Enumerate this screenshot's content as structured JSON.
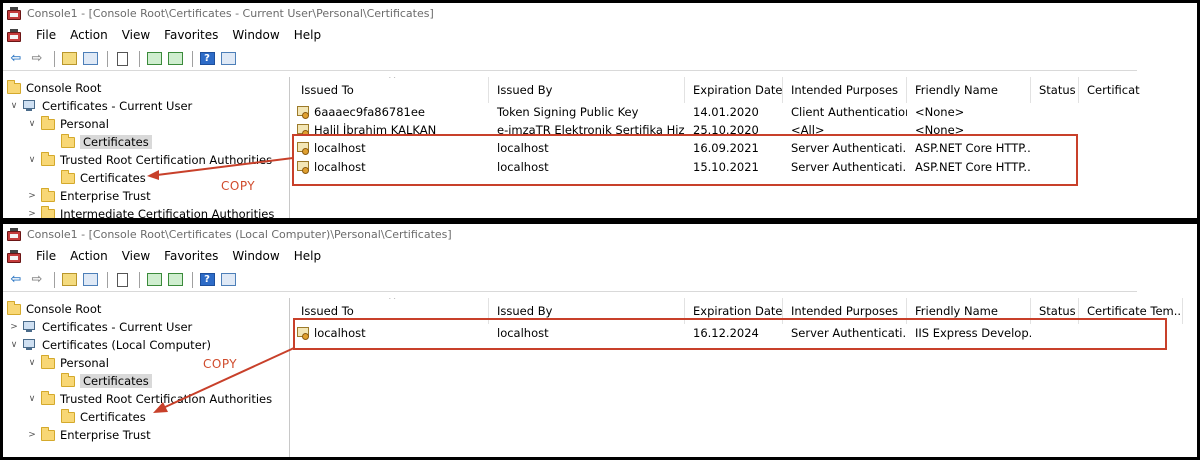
{
  "colors": {
    "annotation": "#c8402a",
    "selection": "#d9d9d9"
  },
  "annotation": {
    "copy_label": "COPY"
  },
  "toolbar_icons": [
    "back-arrow-icon",
    "forward-arrow-icon",
    "up-folder-icon",
    "show-hide-tree-icon",
    "properties-icon",
    "refresh-icon",
    "export-list-icon",
    "help-icon",
    "action-pane-icon"
  ],
  "menu": [
    "File",
    "Action",
    "View",
    "Favorites",
    "Window",
    "Help"
  ],
  "window1": {
    "title": "Console1 - [Console Root\\Certificates - Current User\\Personal\\Certificates]",
    "tree": [
      {
        "label": "Console Root",
        "chev": "",
        "icon": "folder"
      },
      {
        "label": "Certificates - Current User",
        "chev": "∨",
        "icon": "cert-store"
      },
      {
        "label": "Personal",
        "chev": "∨",
        "icon": "folder"
      },
      {
        "label": "Certificates",
        "chev": "",
        "icon": "folder",
        "selected": true
      },
      {
        "label": "Trusted Root Certification Authorities",
        "chev": "∨",
        "icon": "folder"
      },
      {
        "label": "Certificates",
        "chev": "",
        "icon": "folder"
      },
      {
        "label": "Enterprise Trust",
        "chev": ">",
        "icon": "folder"
      },
      {
        "label": "Intermediate Certification Authorities",
        "chev": ">",
        "icon": "folder"
      }
    ],
    "columns": [
      "Issued To",
      "Issued By",
      "Expiration Date",
      "Intended Purposes",
      "Friendly Name",
      "Status",
      "Certificat"
    ],
    "rows": [
      [
        "6aaaec9fa86781ee",
        "Token Signing Public Key",
        "14.01.2020",
        "Client Authentication",
        "<None>",
        "",
        ""
      ],
      [
        "Halil İbrahim KALKAN",
        "e-imzaTR Elektronik Sertifika Hiz...",
        "25.10.2020",
        "<All>",
        "<None>",
        "",
        ""
      ],
      [
        "localhost",
        "localhost",
        "16.09.2021",
        "Server Authenticati...",
        "ASP.NET Core HTTP...",
        "",
        ""
      ],
      [
        "localhost",
        "localhost",
        "15.10.2021",
        "Server Authenticati...",
        "ASP.NET Core HTTP...",
        "",
        ""
      ]
    ]
  },
  "window2": {
    "title": "Console1 - [Console Root\\Certificates (Local Computer)\\Personal\\Certificates]",
    "tree": [
      {
        "label": "Console Root",
        "chev": "",
        "icon": "folder"
      },
      {
        "label": "Certificates - Current User",
        "chev": ">",
        "icon": "cert-store"
      },
      {
        "label": "Certificates (Local Computer)",
        "chev": "∨",
        "icon": "cert-store"
      },
      {
        "label": "Personal",
        "chev": "∨",
        "icon": "folder"
      },
      {
        "label": "Certificates",
        "chev": "",
        "icon": "folder",
        "selected": true
      },
      {
        "label": "Trusted Root Certification Authorities",
        "chev": "∨",
        "icon": "folder"
      },
      {
        "label": "Certificates",
        "chev": "",
        "icon": "folder"
      },
      {
        "label": "Enterprise Trust",
        "chev": ">",
        "icon": "folder"
      }
    ],
    "columns": [
      "Issued To",
      "Issued By",
      "Expiration Date",
      "Intended Purposes",
      "Friendly Name",
      "Status",
      "Certificate Tem..."
    ],
    "rows": [
      [
        "localhost",
        "localhost",
        "16.12.2024",
        "Server Authenticati...",
        "IIS Express Develop...",
        "",
        ""
      ]
    ]
  }
}
